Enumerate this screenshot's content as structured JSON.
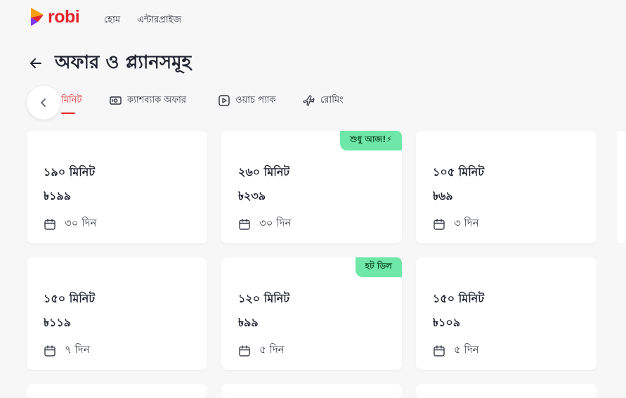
{
  "brand": {
    "name": "robi",
    "color": "#e3262a"
  },
  "nav": {
    "items": [
      "হোম",
      "এন্টারপ্রাইজ"
    ]
  },
  "page": {
    "title": "অফার ও প্ল্যানসমূহ"
  },
  "tabs": [
    {
      "label": "মিনিট",
      "icon": "",
      "active": true
    },
    {
      "label": "ক্যাশব্যাক অফার",
      "icon": "cash-icon",
      "active": false
    },
    {
      "label": "ওয়াচ প্যাক",
      "icon": "play-icon",
      "active": false
    },
    {
      "label": "রোমিং",
      "icon": "plane-icon",
      "active": false
    }
  ],
  "cards": [
    {
      "minutes": "১৯০ মিনিট",
      "price": "৳১৯৯",
      "validity": "৩০ দিন",
      "badge": ""
    },
    {
      "minutes": "২৬০ মিনিট",
      "price": "৳২৩৯",
      "validity": "৩০ দিন",
      "badge": "শুধু আজ!⚡"
    },
    {
      "minutes": "১০৫ মিনিট",
      "price": "৳৬৯",
      "validity": "৩ দিন",
      "badge": ""
    },
    {
      "minutes": "১৫০ মিনিট",
      "price": "৳১১৯",
      "validity": "৭ দিন",
      "badge": ""
    },
    {
      "minutes": "১২০ মিনিট",
      "price": "৳৯৯",
      "validity": "৫ দিন",
      "badge": "হট ডিল"
    },
    {
      "minutes": "১৫০ মিনিট",
      "price": "৳১০৯",
      "validity": "৫ দিন",
      "badge": ""
    }
  ],
  "colors": {
    "accent": "#e3262a",
    "badge": "#6ee7a8",
    "background": "#f7f7f8"
  }
}
